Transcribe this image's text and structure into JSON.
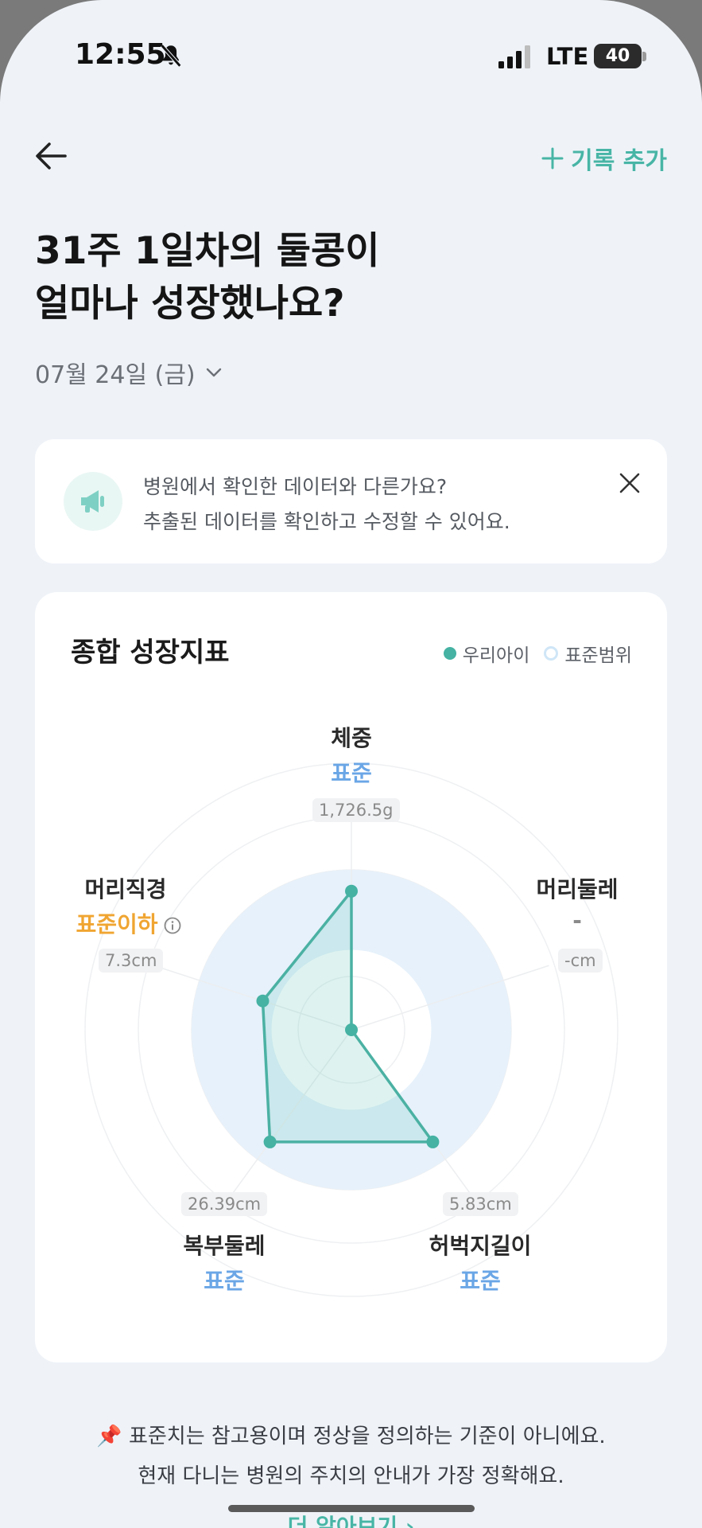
{
  "status_bar": {
    "time": "12:55",
    "network": "LTE",
    "battery": "40",
    "icons": [
      "bell-slash-icon",
      "signal-icon"
    ]
  },
  "header": {
    "back_icon": "arrow-left-icon",
    "add_record_label": "기록 추가"
  },
  "title_line1": "31주 1일차의 둘콩이",
  "title_line2": "얼마나 성장했나요?",
  "date_select": {
    "value": "07월 24일 (금)"
  },
  "notice": {
    "icon": "megaphone-icon",
    "line1": "병원에서 확인한 데이터와 다른가요?",
    "line2": "추출된 데이터를 확인하고 수정할 수 있어요."
  },
  "chart_data": {
    "type": "radar",
    "title": "종합 성장지표",
    "legend": [
      {
        "name": "우리아이",
        "color": "#45b2a3"
      },
      {
        "name": "표준범위",
        "color": "#cfe6f7"
      }
    ],
    "axes": [
      {
        "name": "체중",
        "status": "표준",
        "value": "1,726.5g",
        "level": 0.52
      },
      {
        "name": "머리둘레",
        "status": "-",
        "value": "-cm",
        "level": 0.0
      },
      {
        "name": "허벅지길이",
        "status": "표준",
        "value": "5.83cm",
        "level": 0.52
      },
      {
        "name": "복부둘레",
        "status": "표준",
        "value": "26.39cm",
        "level": 0.52
      },
      {
        "name": "머리직경",
        "status": "표준이하",
        "value": "7.3cm",
        "level": 0.35
      }
    ],
    "standard_range": [
      0.3,
      0.6
    ],
    "rings": 5
  },
  "footer": {
    "pin_icon": "pushpin-icon",
    "line1": "표준치는 참고용이며 정상을 정의하는 기준이 아니에요.",
    "line2": "현재 다니는 병원의 주치의 안내가 가장 정확해요.",
    "learn_more": "더 알아보기"
  },
  "colors": {
    "accent": "#48b5a6",
    "standard_blue": "#6aa6e6",
    "below_orange": "#f0a531",
    "background": "#eff3f8"
  }
}
